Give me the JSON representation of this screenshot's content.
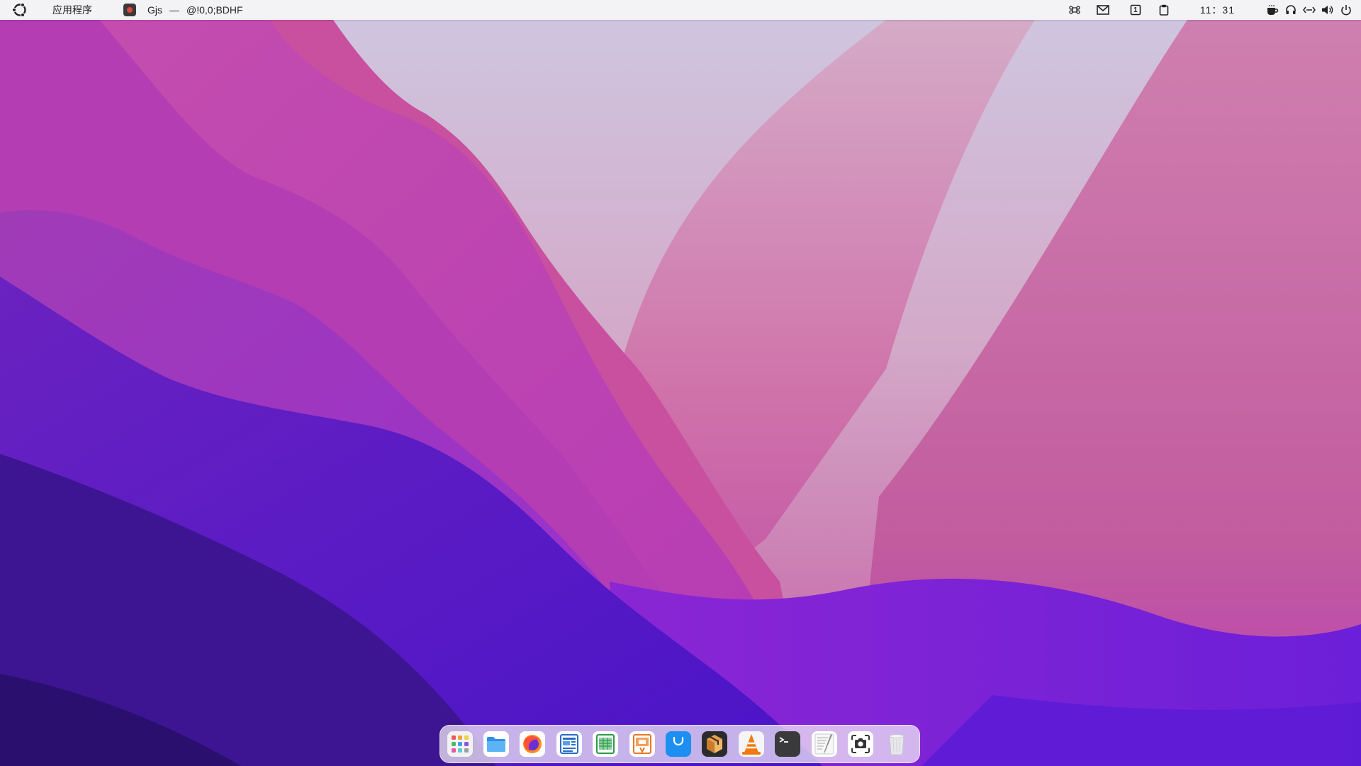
{
  "topbar": {
    "distro_logo_icon": "ubuntu-logo-icon",
    "apps_menu_label": "应用程序",
    "active_app": {
      "icon": "gjs-app-icon",
      "name": "Gjs",
      "separator": "—",
      "window_title": "@!0,0;BDHF"
    },
    "tray": [
      {
        "name": "command-key-icon"
      },
      {
        "name": "mail-icon"
      },
      {
        "name": "workspace-1-icon",
        "label": "1"
      },
      {
        "name": "clipboard-icon"
      }
    ],
    "clock": "11：31",
    "status_icons": [
      {
        "name": "coffee-icon"
      },
      {
        "name": "headphones-icon"
      },
      {
        "name": "network-wired-icon"
      },
      {
        "name": "volume-icon"
      },
      {
        "name": "power-icon"
      }
    ]
  },
  "dock": {
    "items": [
      {
        "name": "app-grid-launcher",
        "icon": "app-grid-icon"
      },
      {
        "name": "files-app",
        "icon": "folder-icon"
      },
      {
        "name": "firefox-app",
        "icon": "firefox-icon"
      },
      {
        "name": "writer-app",
        "icon": "document-writer-icon"
      },
      {
        "name": "calc-app",
        "icon": "spreadsheet-icon"
      },
      {
        "name": "impress-app",
        "icon": "presentation-icon"
      },
      {
        "name": "software-store-app",
        "icon": "shopping-bag-icon"
      },
      {
        "name": "archive-manager-app",
        "icon": "archive-box-icon"
      },
      {
        "name": "vlc-app",
        "icon": "vlc-cone-icon"
      },
      {
        "name": "terminal-app",
        "icon": "terminal-icon"
      },
      {
        "name": "text-editor-app",
        "icon": "text-editor-icon"
      },
      {
        "name": "screenshot-app",
        "icon": "camera-screenshot-icon"
      },
      {
        "name": "trash",
        "icon": "trash-icon"
      }
    ]
  },
  "colors": {
    "wallpaper_sky": "#cdc2df",
    "wallpaper_pink": "#c954a8",
    "wallpaper_magenta": "#b43db5",
    "wallpaper_violet": "#5a1ec4",
    "wallpaper_deep": "#2c1474",
    "topbar_bg": "#f3f2f4"
  }
}
